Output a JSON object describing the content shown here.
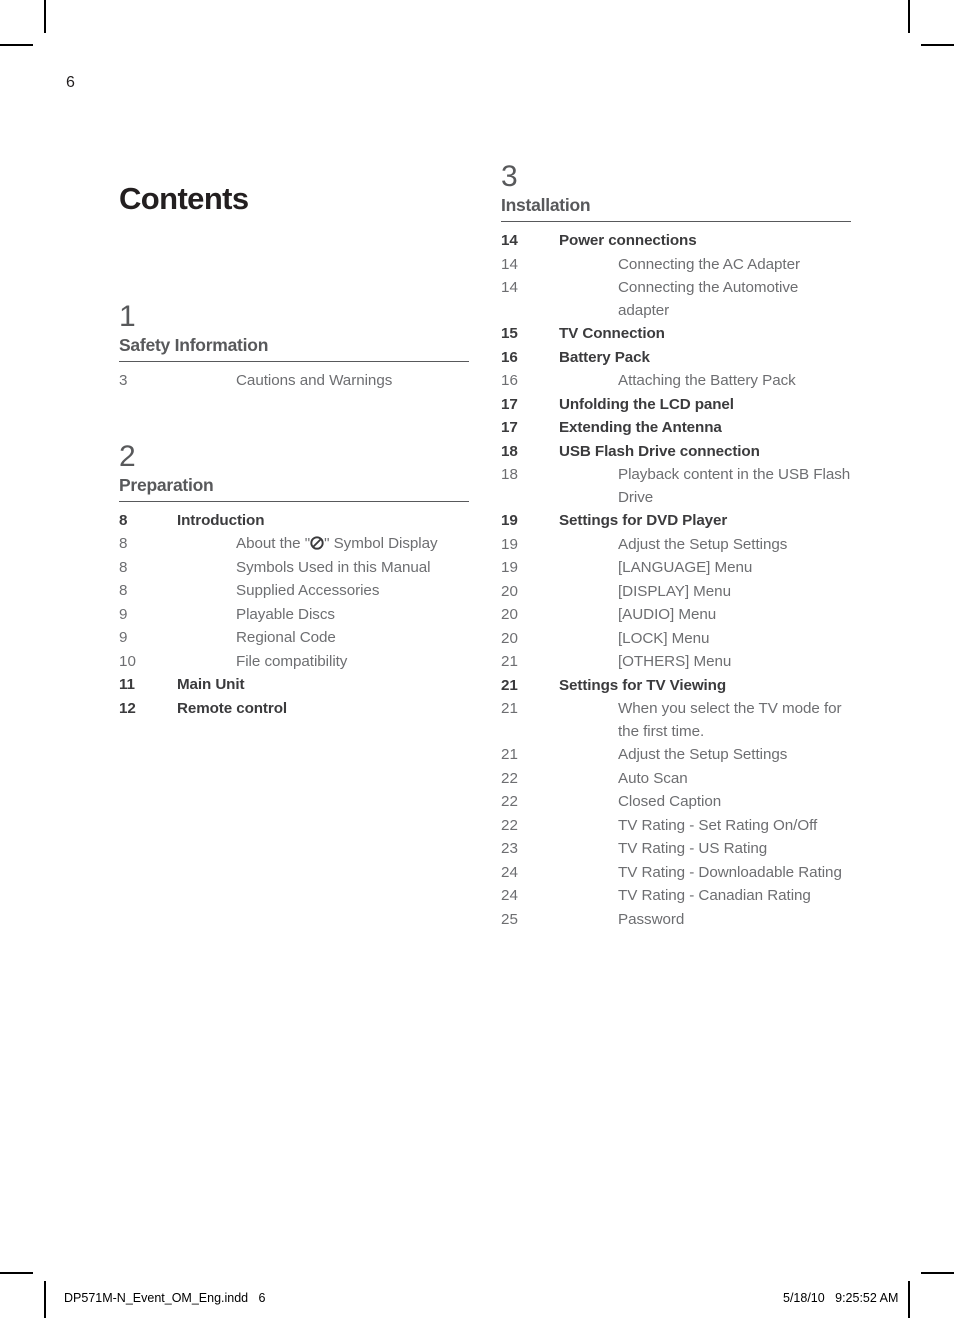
{
  "page": {
    "number": "6",
    "title": "Contents"
  },
  "footer": {
    "file_name": "DP571M-N_Event_OM_Eng.indd   6",
    "timestamp": "5/18/10   9:25:52 AM"
  },
  "symbols": {
    "prohibition": "no-entry-symbol"
  },
  "columns": {
    "left": [
      {
        "number": "1",
        "name": "Safety Information",
        "entries": [
          {
            "page": "3",
            "label": "Cautions and Warnings",
            "level": 2
          }
        ]
      },
      {
        "number": "2",
        "name": "Preparation",
        "entries": [
          {
            "page": "8",
            "label": "Introduction",
            "level": 1
          },
          {
            "page": "8",
            "label": "About the \"⊘\" Symbol Display",
            "level": 2,
            "has_symbol": true,
            "before_symbol": "About the \"",
            "after_symbol": "\" Symbol Display"
          },
          {
            "page": "8",
            "label": "Symbols Used in this Manual",
            "level": 2
          },
          {
            "page": "8",
            "label": "Supplied Accessories",
            "level": 2
          },
          {
            "page": "9",
            "label": "Playable Discs",
            "level": 2
          },
          {
            "page": "9",
            "label": "Regional Code",
            "level": 2
          },
          {
            "page": "10",
            "label": "File compatibility",
            "level": 2
          },
          {
            "page": "11",
            "label": "Main Unit",
            "level": 1
          },
          {
            "page": "12",
            "label": "Remote control",
            "level": 1
          }
        ]
      }
    ],
    "right": [
      {
        "number": "3",
        "name": "Installation",
        "entries": [
          {
            "page": "14",
            "label": "Power connections",
            "level": 1
          },
          {
            "page": "14",
            "label": "Connecting the AC Adapter",
            "level": 2
          },
          {
            "page": "14",
            "label": "Connecting the Automotive adapter",
            "level": 2
          },
          {
            "page": "15",
            "label": "TV Connection",
            "level": 1
          },
          {
            "page": "16",
            "label": "Battery Pack",
            "level": 1
          },
          {
            "page": "16",
            "label": "Attaching the Battery Pack",
            "level": 2
          },
          {
            "page": "17",
            "label": "Unfolding the LCD panel",
            "level": 1
          },
          {
            "page": "17",
            "label": "Extending the Antenna",
            "level": 1
          },
          {
            "page": "18",
            "label": "USB Flash Drive connection",
            "level": 1
          },
          {
            "page": "18",
            "label": "Playback content in the USB Flash Drive",
            "level": 2
          },
          {
            "page": "19",
            "label": "Settings for DVD Player",
            "level": 1
          },
          {
            "page": "19",
            "label": "Adjust the Setup Settings",
            "level": 2
          },
          {
            "page": "19",
            "label": "[LANGUAGE] Menu",
            "level": 2
          },
          {
            "page": "20",
            "label": "[DISPLAY] Menu",
            "level": 2
          },
          {
            "page": "20",
            "label": "[AUDIO] Menu",
            "level": 2
          },
          {
            "page": "20",
            "label": "[LOCK] Menu",
            "level": 2
          },
          {
            "page": "21",
            "label": "[OTHERS] Menu",
            "level": 2
          },
          {
            "page": "21",
            "label": "Settings for TV Viewing",
            "level": 1
          },
          {
            "page": "21",
            "label": "When you select the TV mode for the first time.",
            "level": 2
          },
          {
            "page": "21",
            "label": "Adjust the Setup Settings",
            "level": 2
          },
          {
            "page": "22",
            "label": "Auto Scan",
            "level": 2
          },
          {
            "page": "22",
            "label": "Closed Caption",
            "level": 2
          },
          {
            "page": "22",
            "label": "TV Rating - Set Rating On/Off",
            "level": 2
          },
          {
            "page": "23",
            "label": "TV Rating - US Rating",
            "level": 2
          },
          {
            "page": "24",
            "label": "TV Rating - Downloadable Rating",
            "level": 2
          },
          {
            "page": "24",
            "label": "TV Rating - Canadian Rating",
            "level": 2
          },
          {
            "page": "25",
            "label": "Password",
            "level": 2
          }
        ]
      }
    ]
  },
  "colors": {
    "title": "#231f20",
    "section_heading": "#58595b",
    "entry_sub": "#6d6e71",
    "entry_main": "#3b3b3d",
    "rule": "#58595b"
  }
}
